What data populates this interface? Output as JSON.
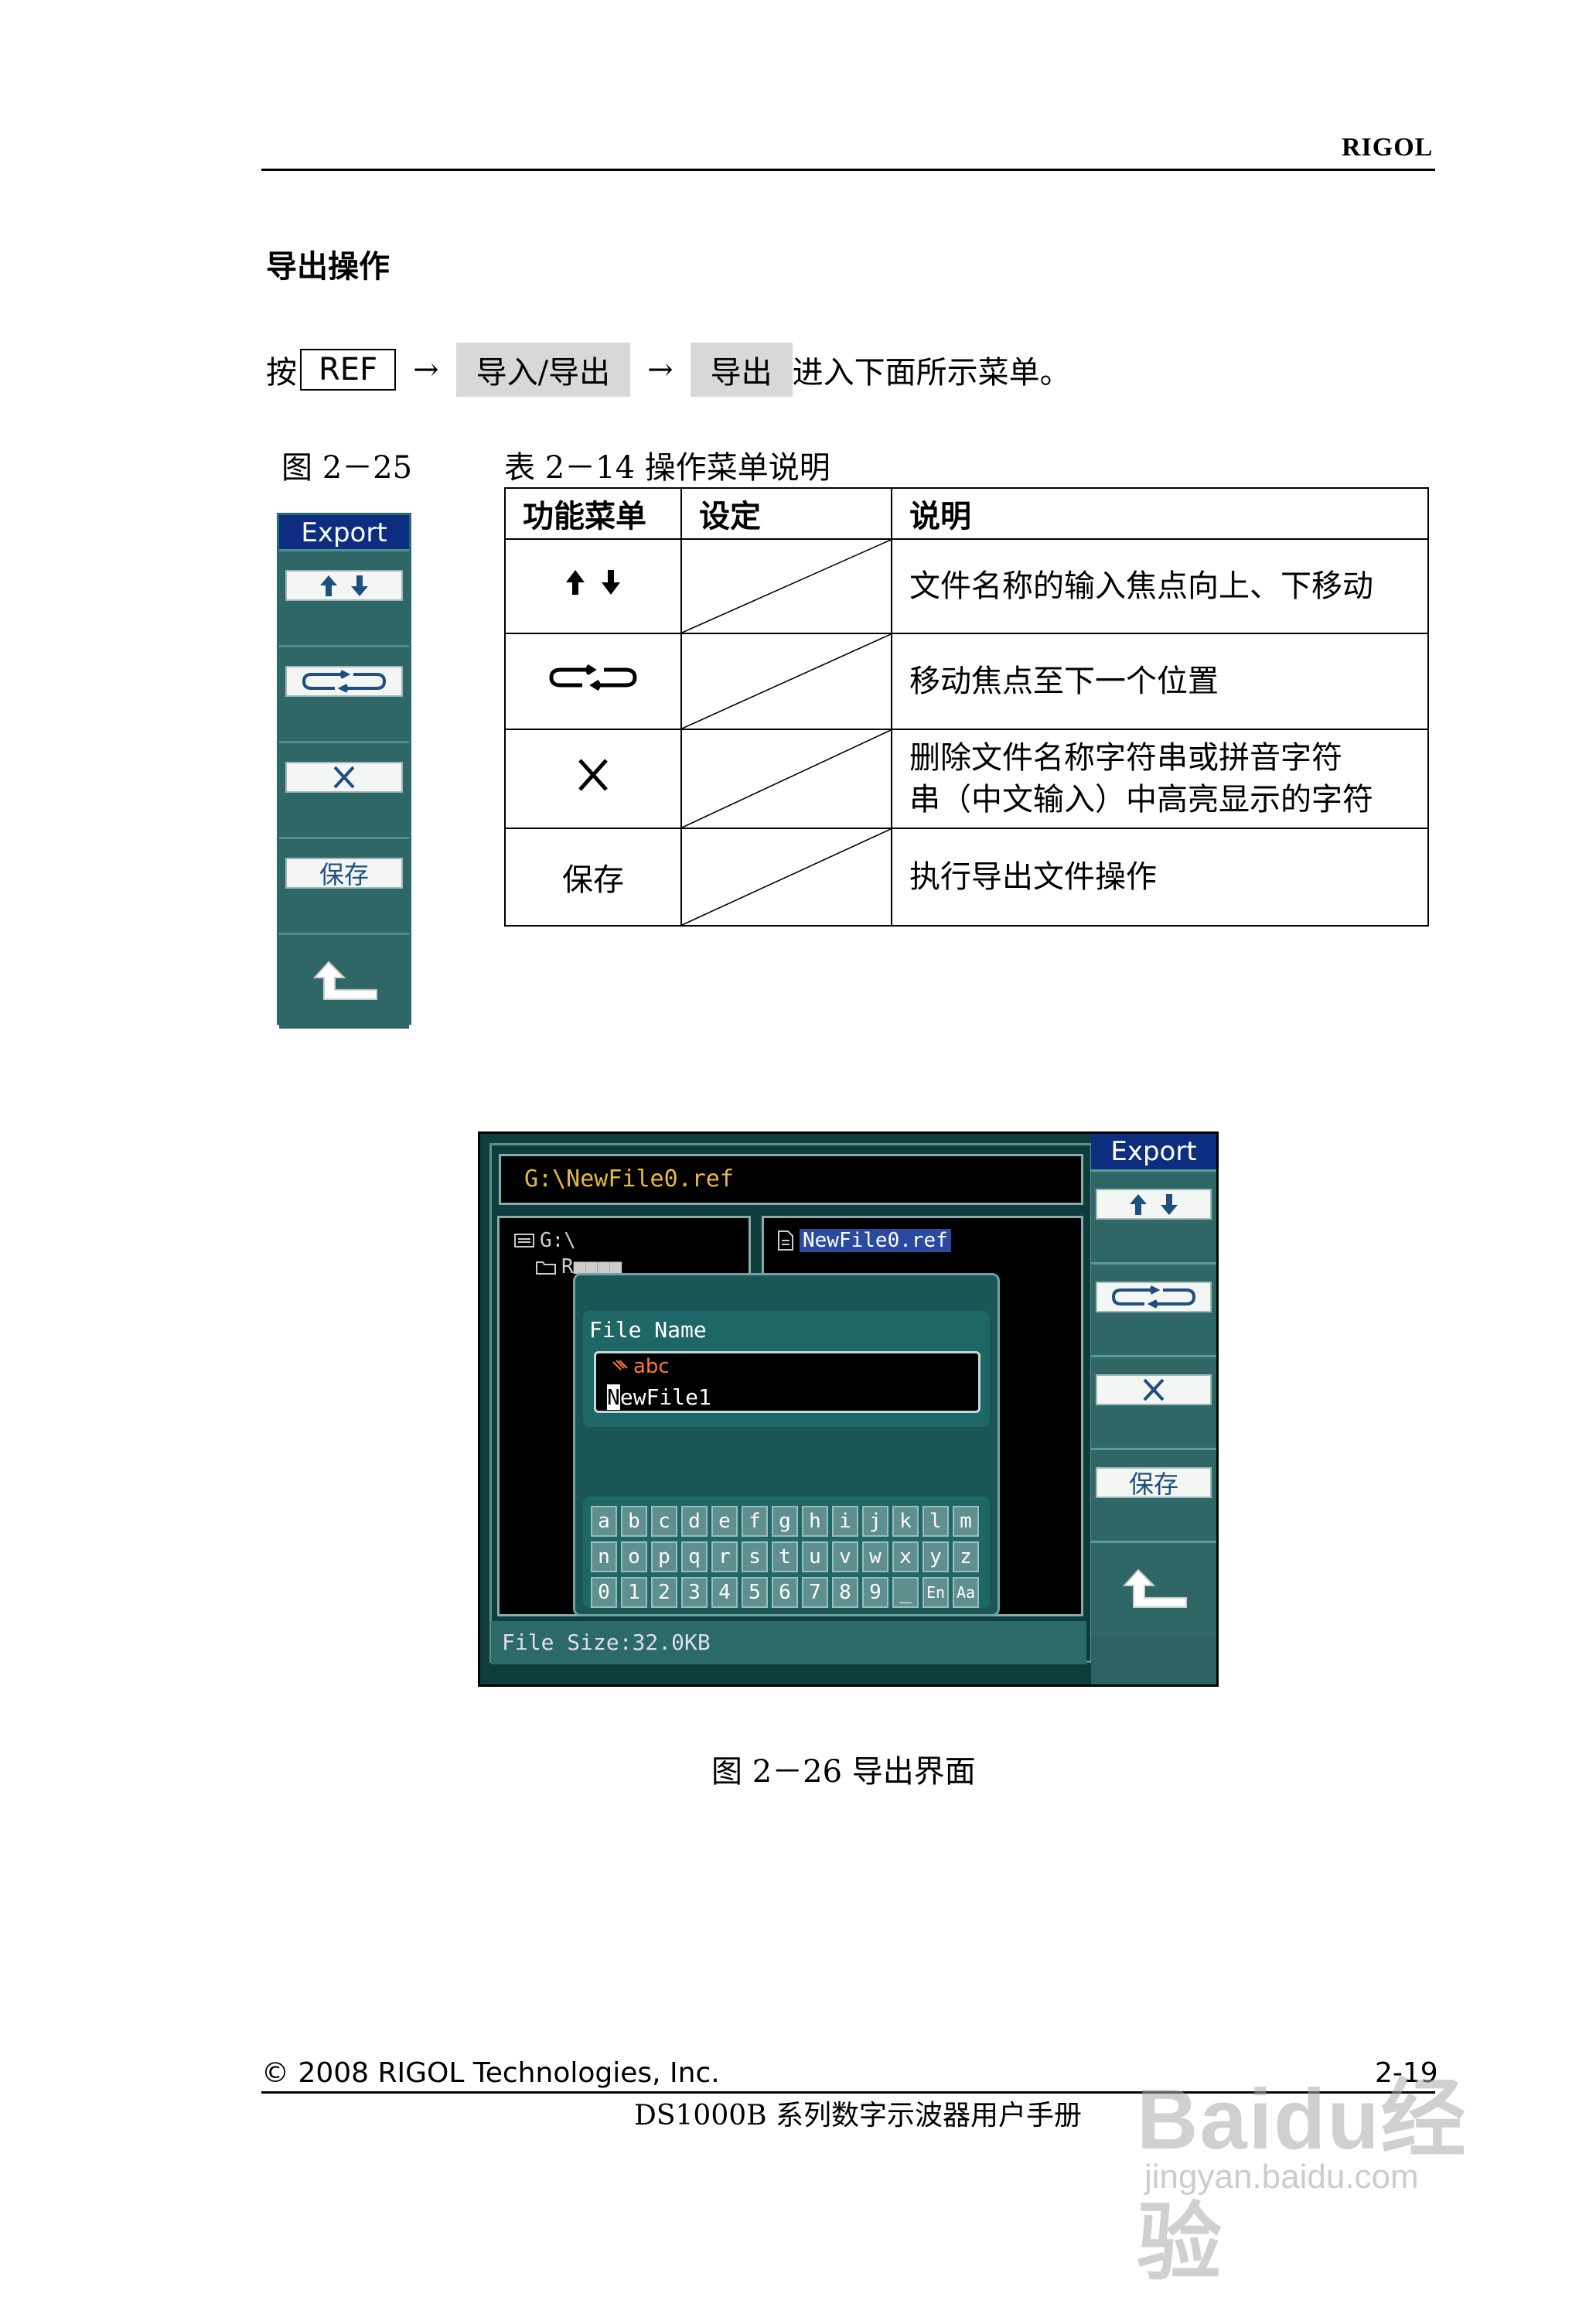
{
  "header": {
    "brand": "RIGOL"
  },
  "section_title": "导出操作",
  "instruction": {
    "press": "按",
    "key": "REF",
    "arrow": "→",
    "softkey1": "导入/导出",
    "softkey2": "导出",
    "suffix": "进入下面所示菜单。"
  },
  "fig_25_caption": "图 2－25",
  "table_caption": "表 2－14  操作菜单说明",
  "menu_panel": {
    "title": "Export",
    "save_label": "保存"
  },
  "table": {
    "headers": [
      "功能菜单",
      "设定",
      "说明"
    ],
    "rows": [
      {
        "func_icon": "up-down-arrows-icon",
        "desc": "文件名称的输入焦点向上、下移动"
      },
      {
        "func_icon": "cycle-arrows-icon",
        "desc": "移动焦点至下一个位置"
      },
      {
        "func_icon": "delete-x-icon",
        "desc_line1": "删除文件名称字符串或拼音字符",
        "desc_line2": "串（中文输入）中高亮显示的字符"
      },
      {
        "func_text": "保存",
        "desc": "执行导出文件操作"
      }
    ]
  },
  "scope": {
    "path": "G:\\NewFile0.ref",
    "tree_root": "G:\\",
    "tree_child": "R■■■■",
    "selected_file": "NewFile0.ref",
    "dialog_label": "File Name",
    "ime_mode": "abc",
    "filename_cursor_char": "N",
    "filename_rest": "ewFile1",
    "file_size": "File Size:32.0KB",
    "keyboard_rows": [
      [
        "a",
        "b",
        "c",
        "d",
        "e",
        "f",
        "g",
        "h",
        "i",
        "j",
        "k",
        "l",
        "m"
      ],
      [
        "n",
        "o",
        "p",
        "q",
        "r",
        "s",
        "t",
        "u",
        "v",
        "w",
        "x",
        "y",
        "z"
      ],
      [
        "0",
        "1",
        "2",
        "3",
        "4",
        "5",
        "6",
        "7",
        "8",
        "9",
        "_",
        "En",
        "Aa"
      ]
    ],
    "menu_title": "Export",
    "menu_save": "保存"
  },
  "fig_26_caption": "图 2－26  导出界面",
  "footer": {
    "copyright": "© 2008 RIGOL Technologies, Inc.",
    "page": "2-19",
    "manual_title": "DS1000B 系列数字示波器用户手册"
  },
  "watermark": {
    "logo_text": "Baidu经验",
    "url": "jingyan.baidu.com"
  }
}
